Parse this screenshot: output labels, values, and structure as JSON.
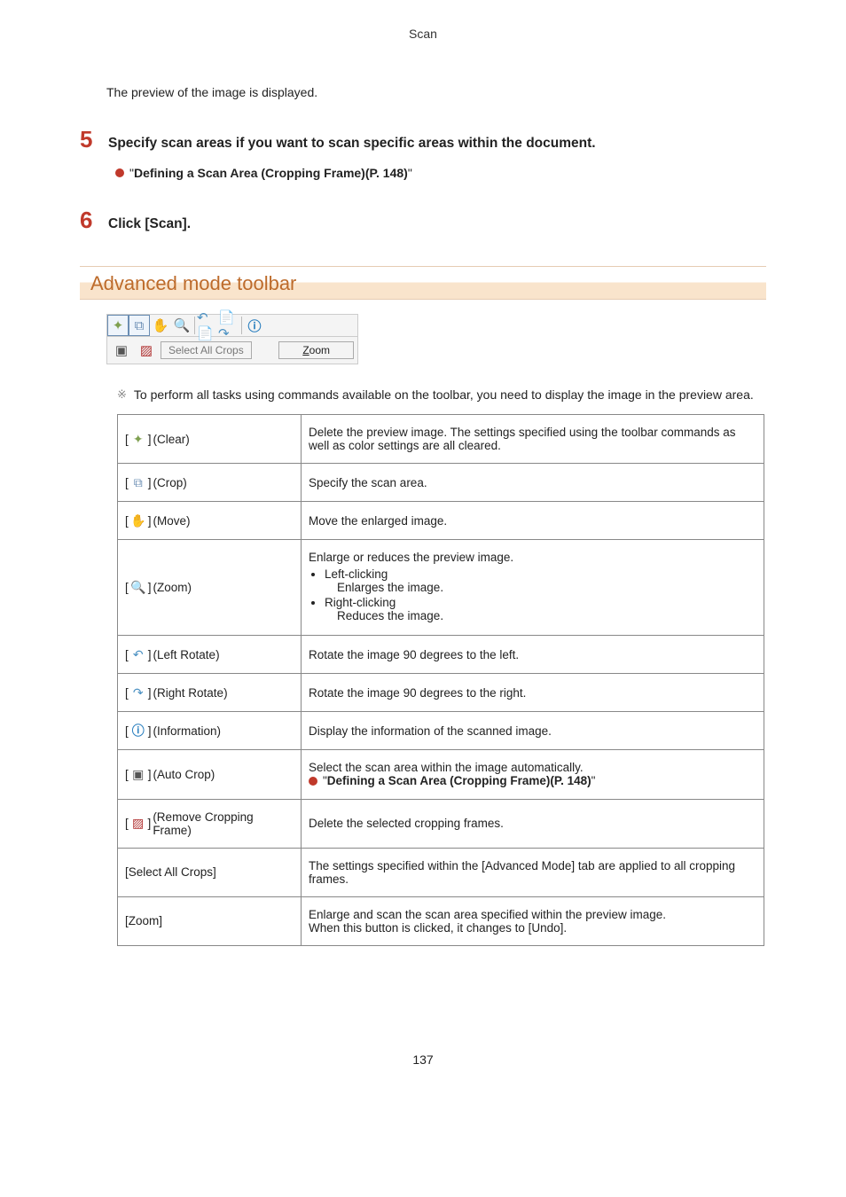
{
  "header": "Scan",
  "intro": "The preview of the image is displayed.",
  "step5": {
    "num": "5",
    "title": "Specify scan areas if you want to scan specific areas within the document."
  },
  "link1": {
    "prefix_quote": "\"",
    "text": " Defining a Scan Area (Cropping Frame)(P. 148) ",
    "suffix_quote": "\""
  },
  "step6": {
    "num": "6",
    "title": "Click [Scan]."
  },
  "section_title": "Advanced mode toolbar",
  "toolbar_buttons": {
    "select_all": "Select All Crops",
    "zoom_u": "Z",
    "zoom_rest": "oom"
  },
  "note": "To perform all tasks using commands available on the toolbar, you need to display the image in the preview area.",
  "table": {
    "clear": {
      "label": "(Clear)",
      "desc": "Delete the preview image. The settings specified using the toolbar commands as well as color settings are all cleared."
    },
    "crop": {
      "label": "(Crop)",
      "desc": "Specify the scan area."
    },
    "move": {
      "label": "(Move)",
      "desc": "Move the enlarged image."
    },
    "zoom": {
      "label": "(Zoom)",
      "desc_head": "Enlarge or reduces the preview image.",
      "li1": "Left-clicking",
      "li1_sub": "Enlarges the image.",
      "li2": "Right-clicking",
      "li2_sub": "Reduces the image."
    },
    "lrot": {
      "label": "(Left Rotate)",
      "desc": "Rotate the image 90 degrees to the left."
    },
    "rrot": {
      "label": "(Right Rotate)",
      "desc": "Rotate the image 90 degrees to the right."
    },
    "info": {
      "label": "(Information)",
      "desc": "Display the information of the scanned image."
    },
    "autocrop": {
      "label": "(Auto Crop)",
      "desc": "Select the scan area within the image automatically.",
      "link_pre": "\"",
      "link_text": " Defining a Scan Area (Cropping Frame)(P. 148) ",
      "link_post": "\""
    },
    "remcrop": {
      "label": "(Remove Cropping Frame)",
      "desc": "Delete the selected cropping frames."
    },
    "selall": {
      "label": "[Select All Crops]",
      "desc": "The settings specified within the [Advanced Mode] tab are applied to all cropping frames."
    },
    "zoombtn": {
      "label": "[Zoom]",
      "desc1": "Enlarge and scan the scan area specified within the preview image.",
      "desc2": "When this button is clicked, it changes to [Undo]."
    }
  },
  "page_number": "137"
}
